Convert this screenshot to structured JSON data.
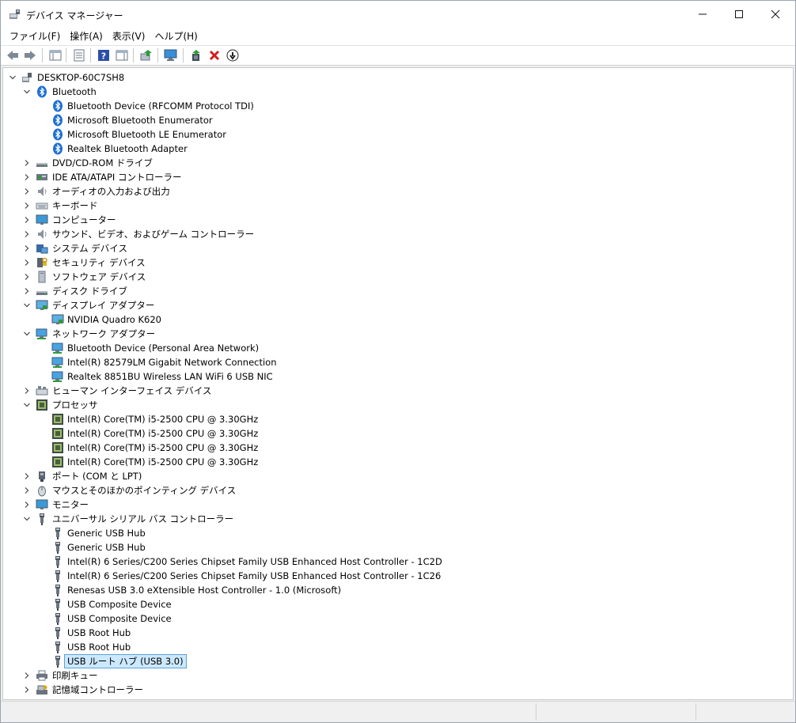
{
  "window": {
    "title": "デバイス マネージャー",
    "minimize_label": "—",
    "maximize_label": "☐",
    "close_label": "✕"
  },
  "menu": [
    "ファイル(F)",
    "操作(A)",
    "表示(V)",
    "ヘルプ(H)"
  ],
  "tree": [
    {
      "label": "DESKTOP-60C7SH8",
      "level": 0,
      "expander": "expanded",
      "icon": "computer"
    },
    {
      "label": "Bluetooth",
      "level": 1,
      "expander": "expanded",
      "icon": "bluetooth"
    },
    {
      "label": "Bluetooth Device (RFCOMM Protocol TDI)",
      "level": 2,
      "expander": "none",
      "icon": "bluetooth"
    },
    {
      "label": "Microsoft Bluetooth Enumerator",
      "level": 2,
      "expander": "none",
      "icon": "bluetooth"
    },
    {
      "label": "Microsoft Bluetooth LE Enumerator",
      "level": 2,
      "expander": "none",
      "icon": "bluetooth"
    },
    {
      "label": "Realtek Bluetooth Adapter",
      "level": 2,
      "expander": "none",
      "icon": "bluetooth"
    },
    {
      "label": "DVD/CD-ROM ドライブ",
      "level": 1,
      "expander": "collapsed",
      "icon": "drive"
    },
    {
      "label": "IDE ATA/ATAPI コントローラー",
      "level": 1,
      "expander": "collapsed",
      "icon": "controller"
    },
    {
      "label": "オーディオの入力および出力",
      "level": 1,
      "expander": "collapsed",
      "icon": "audio"
    },
    {
      "label": "キーボード",
      "level": 1,
      "expander": "collapsed",
      "icon": "keyboard"
    },
    {
      "label": "コンピューター",
      "level": 1,
      "expander": "collapsed",
      "icon": "monitor"
    },
    {
      "label": "サウンド、ビデオ、およびゲーム コントローラー",
      "level": 1,
      "expander": "collapsed",
      "icon": "audio"
    },
    {
      "label": "システム デバイス",
      "level": 1,
      "expander": "collapsed",
      "icon": "system"
    },
    {
      "label": "セキュリティ デバイス",
      "level": 1,
      "expander": "collapsed",
      "icon": "security"
    },
    {
      "label": "ソフトウェア デバイス",
      "level": 1,
      "expander": "collapsed",
      "icon": "software"
    },
    {
      "label": "ディスク ドライブ",
      "level": 1,
      "expander": "collapsed",
      "icon": "drive"
    },
    {
      "label": "ディスプレイ アダプター",
      "level": 1,
      "expander": "expanded",
      "icon": "display"
    },
    {
      "label": "NVIDIA Quadro K620",
      "level": 2,
      "expander": "none",
      "icon": "display"
    },
    {
      "label": "ネットワーク アダプター",
      "level": 1,
      "expander": "expanded",
      "icon": "network"
    },
    {
      "label": "Bluetooth Device (Personal Area Network)",
      "level": 2,
      "expander": "none",
      "icon": "network"
    },
    {
      "label": "Intel(R) 82579LM Gigabit Network Connection",
      "level": 2,
      "expander": "none",
      "icon": "network"
    },
    {
      "label": "Realtek 8851BU Wireless LAN WiFi 6 USB NIC",
      "level": 2,
      "expander": "none",
      "icon": "network"
    },
    {
      "label": "ヒューマン インターフェイス デバイス",
      "level": 1,
      "expander": "collapsed",
      "icon": "hid"
    },
    {
      "label": "プロセッサ",
      "level": 1,
      "expander": "expanded",
      "icon": "cpu"
    },
    {
      "label": "Intel(R) Core(TM) i5-2500 CPU @ 3.30GHz",
      "level": 2,
      "expander": "none",
      "icon": "cpu"
    },
    {
      "label": "Intel(R) Core(TM) i5-2500 CPU @ 3.30GHz",
      "level": 2,
      "expander": "none",
      "icon": "cpu"
    },
    {
      "label": "Intel(R) Core(TM) i5-2500 CPU @ 3.30GHz",
      "level": 2,
      "expander": "none",
      "icon": "cpu"
    },
    {
      "label": "Intel(R) Core(TM) i5-2500 CPU @ 3.30GHz",
      "level": 2,
      "expander": "none",
      "icon": "cpu"
    },
    {
      "label": "ポート (COM と LPT)",
      "level": 1,
      "expander": "collapsed",
      "icon": "port"
    },
    {
      "label": "マウスとそのほかのポインティング デバイス",
      "level": 1,
      "expander": "collapsed",
      "icon": "mouse"
    },
    {
      "label": "モニター",
      "level": 1,
      "expander": "collapsed",
      "icon": "monitor"
    },
    {
      "label": "ユニバーサル シリアル バス コントローラー",
      "level": 1,
      "expander": "expanded",
      "icon": "usb"
    },
    {
      "label": "Generic USB Hub",
      "level": 2,
      "expander": "none",
      "icon": "usb"
    },
    {
      "label": "Generic USB Hub",
      "level": 2,
      "expander": "none",
      "icon": "usb"
    },
    {
      "label": "Intel(R) 6 Series/C200 Series Chipset Family USB Enhanced Host Controller - 1C2D",
      "level": 2,
      "expander": "none",
      "icon": "usb"
    },
    {
      "label": "Intel(R) 6 Series/C200 Series Chipset Family USB Enhanced Host Controller - 1C26",
      "level": 2,
      "expander": "none",
      "icon": "usb"
    },
    {
      "label": "Renesas USB 3.0 eXtensible Host Controller - 1.0 (Microsoft)",
      "level": 2,
      "expander": "none",
      "icon": "usb"
    },
    {
      "label": "USB Composite Device",
      "level": 2,
      "expander": "none",
      "icon": "usb"
    },
    {
      "label": "USB Composite Device",
      "level": 2,
      "expander": "none",
      "icon": "usb"
    },
    {
      "label": "USB Root Hub",
      "level": 2,
      "expander": "none",
      "icon": "usb"
    },
    {
      "label": "USB Root Hub",
      "level": 2,
      "expander": "none",
      "icon": "usb"
    },
    {
      "label": "USB ルート ハブ (USB 3.0)",
      "level": 2,
      "expander": "none",
      "icon": "usb",
      "selected": true
    },
    {
      "label": "印刷キュー",
      "level": 1,
      "expander": "collapsed",
      "icon": "printer"
    },
    {
      "label": "記憶域コントローラー",
      "level": 1,
      "expander": "collapsed",
      "icon": "storage"
    }
  ],
  "colors": {
    "bluetooth": "#1c6fd6",
    "selection": "#cce8ff",
    "uninstall": "#d11e1e"
  }
}
